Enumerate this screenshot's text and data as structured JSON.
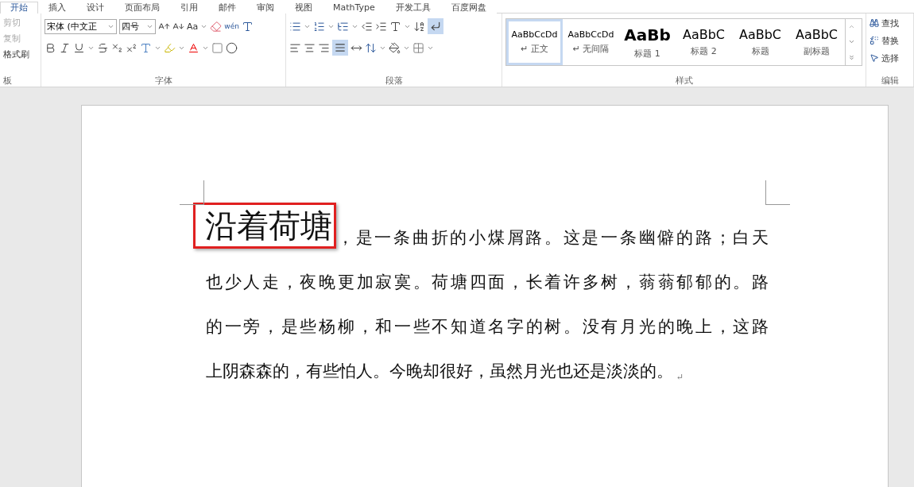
{
  "tabs": [
    {
      "label": "开始",
      "selected": true
    },
    {
      "label": "插入",
      "selected": false
    },
    {
      "label": "设计",
      "selected": false
    },
    {
      "label": "页面布局",
      "selected": false
    },
    {
      "label": "引用",
      "selected": false
    },
    {
      "label": "邮件",
      "selected": false
    },
    {
      "label": "审阅",
      "selected": false
    },
    {
      "label": "视图",
      "selected": false
    },
    {
      "label": "MathType",
      "selected": false
    },
    {
      "label": "开发工具",
      "selected": false
    },
    {
      "label": "百度网盘",
      "selected": false
    }
  ],
  "clipboard": {
    "items": [
      {
        "label": "剪切",
        "disabled": true
      },
      {
        "label": "复制",
        "disabled": true
      },
      {
        "label": "格式刷",
        "disabled": false
      }
    ],
    "group_label": "板"
  },
  "font": {
    "name": "宋体 (中文正",
    "size": "四号",
    "case_button": "Aa",
    "pinyin": "wén",
    "group_label": "字体"
  },
  "paragraph": {
    "group_label": "段落"
  },
  "styles": {
    "items": [
      {
        "preview": "AaBbCcDd",
        "label": "正文",
        "mark": "↵",
        "kind": "small",
        "selected": true
      },
      {
        "preview": "AaBbCcDd",
        "label": "无间隔",
        "mark": "↵",
        "kind": "small",
        "selected": false
      },
      {
        "preview": "AaBb",
        "label": "标题 1",
        "kind": "heavy",
        "selected": false
      },
      {
        "preview": "AaBbC",
        "label": "标题 2",
        "kind": "large",
        "selected": false
      },
      {
        "preview": "AaBbC",
        "label": "标题",
        "kind": "large",
        "selected": false
      },
      {
        "preview": "AaBbC",
        "label": "副标题",
        "kind": "large",
        "selected": false
      }
    ],
    "group_label": "样式"
  },
  "editing": {
    "items": [
      {
        "label": "查找",
        "kind": "find"
      },
      {
        "label": "替换",
        "kind": "replace"
      },
      {
        "label": "选择",
        "kind": "select"
      }
    ],
    "group_label": "编辑"
  },
  "document": {
    "lines": [
      {
        "highlight": "沿着荷塘",
        "text": "，是一条曲折的小煤屑路。这是一条幽僻的路；白天"
      },
      {
        "text": "也少人走，夜晚更加寂寞。荷塘四面，长着许多树，蓊蓊郁郁的。路"
      },
      {
        "text": "的一旁，是些杨柳，和一些不知道名字的树。没有月光的晚上，这路"
      },
      {
        "text": "上阴森森的，有些怕人。今晚却很好，虽然月光也还是淡淡的。",
        "last": true
      }
    ],
    "paragraph_mark": "↵"
  }
}
